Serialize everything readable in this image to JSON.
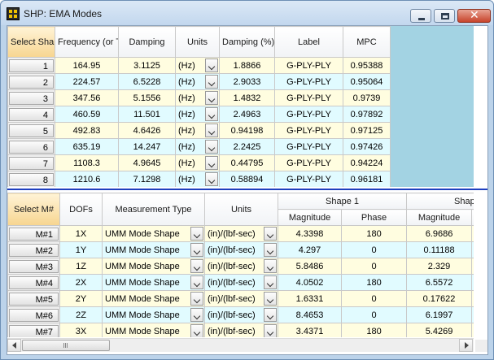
{
  "window": {
    "title": "SHP: EMA Modes",
    "icon": "grid-app-icon",
    "buttons": [
      "minimize-icon",
      "maximize-icon",
      "close-icon"
    ]
  },
  "modes_table": {
    "headers": [
      "Select Shape",
      "Frequency (or Time)",
      "Damping",
      "Units",
      "Damping (%)",
      "Label",
      "MPC"
    ],
    "rows": [
      {
        "select": "1",
        "frequency": "164.95",
        "damping": "3.1125",
        "units": "(Hz)",
        "damping_pct": "1.8866",
        "label": "G-PLY-PLY",
        "mpc": "0.95388"
      },
      {
        "select": "2",
        "frequency": "224.57",
        "damping": "6.5228",
        "units": "(Hz)",
        "damping_pct": "2.9033",
        "label": "G-PLY-PLY",
        "mpc": "0.95064"
      },
      {
        "select": "3",
        "frequency": "347.56",
        "damping": "5.1556",
        "units": "(Hz)",
        "damping_pct": "1.4832",
        "label": "G-PLY-PLY",
        "mpc": "0.9739"
      },
      {
        "select": "4",
        "frequency": "460.59",
        "damping": "11.501",
        "units": "(Hz)",
        "damping_pct": "2.4963",
        "label": "G-PLY-PLY",
        "mpc": "0.97892"
      },
      {
        "select": "5",
        "frequency": "492.83",
        "damping": "4.6426",
        "units": "(Hz)",
        "damping_pct": "0.94198",
        "label": "G-PLY-PLY",
        "mpc": "0.97125"
      },
      {
        "select": "6",
        "frequency": "635.19",
        "damping": "14.247",
        "units": "(Hz)",
        "damping_pct": "2.2425",
        "label": "G-PLY-PLY",
        "mpc": "0.97426"
      },
      {
        "select": "7",
        "frequency": "1108.3",
        "damping": "4.9645",
        "units": "(Hz)",
        "damping_pct": "0.44795",
        "label": "G-PLY-PLY",
        "mpc": "0.94224"
      },
      {
        "select": "8",
        "frequency": "1210.6",
        "damping": "7.1298",
        "units": "(Hz)",
        "damping_pct": "0.58894",
        "label": "G-PLY-PLY",
        "mpc": "0.96181"
      }
    ]
  },
  "measurements_table": {
    "headers": {
      "select": "Select M#",
      "dofs": "DOFs",
      "measurement_type": "Measurement Type",
      "units": "Units",
      "shape1": "Shape 1",
      "shape2_partial": "Shap",
      "magnitude": "Magnitude",
      "phase": "Phase"
    },
    "rows": [
      {
        "select": "M#1",
        "dof": "1X",
        "type": "UMM Mode Shape",
        "units": "(in)/(lbf-sec)",
        "mag1": "4.3398",
        "phase1": "180",
        "mag2": "6.9686"
      },
      {
        "select": "M#2",
        "dof": "1Y",
        "type": "UMM Mode Shape",
        "units": "(in)/(lbf-sec)",
        "mag1": "4.297",
        "phase1": "0",
        "mag2": "0.11188"
      },
      {
        "select": "M#3",
        "dof": "1Z",
        "type": "UMM Mode Shape",
        "units": "(in)/(lbf-sec)",
        "mag1": "5.8486",
        "phase1": "0",
        "mag2": "2.329"
      },
      {
        "select": "M#4",
        "dof": "2X",
        "type": "UMM Mode Shape",
        "units": "(in)/(lbf-sec)",
        "mag1": "4.0502",
        "phase1": "180",
        "mag2": "6.5572"
      },
      {
        "select": "M#5",
        "dof": "2Y",
        "type": "UMM Mode Shape",
        "units": "(in)/(lbf-sec)",
        "mag1": "1.6331",
        "phase1": "0",
        "mag2": "0.17622"
      },
      {
        "select": "M#6",
        "dof": "2Z",
        "type": "UMM Mode Shape",
        "units": "(in)/(lbf-sec)",
        "mag1": "8.4653",
        "phase1": "0",
        "mag2": "6.1997"
      },
      {
        "select": "M#7",
        "dof": "3X",
        "type": "UMM Mode Shape",
        "units": "(in)/(lbf-sec)",
        "mag1": "3.4371",
        "phase1": "180",
        "mag2": "5.4269"
      }
    ]
  },
  "scrollbars": {
    "top_vertical": {
      "position": 0.0
    },
    "bottom_vertical": {
      "position": 0.0
    },
    "bottom_horizontal": {
      "position": 0.0
    }
  }
}
